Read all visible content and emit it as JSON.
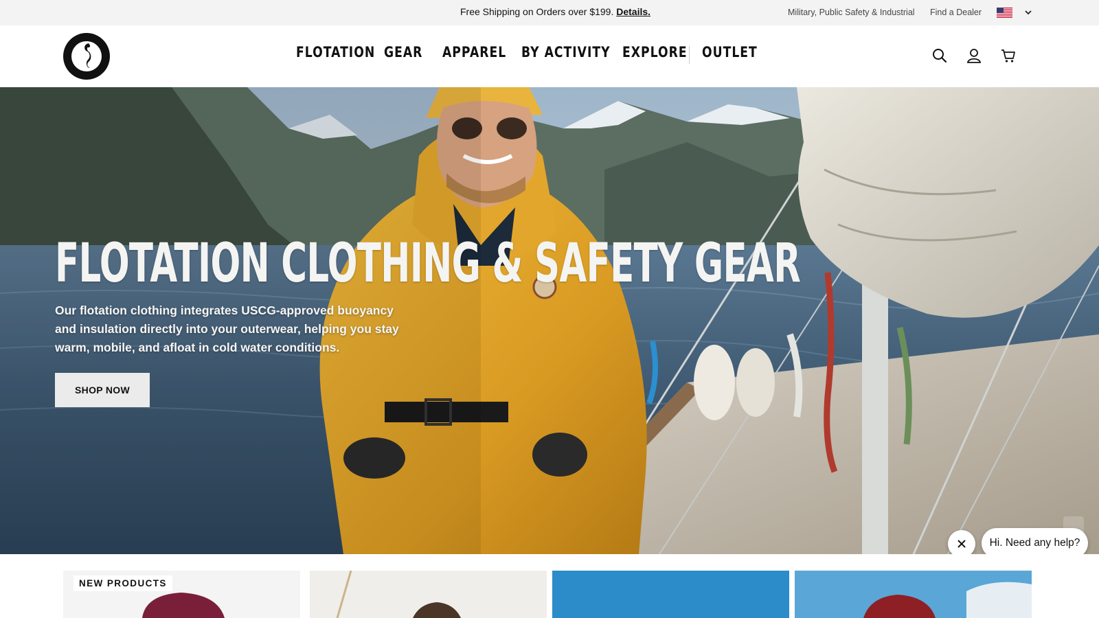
{
  "announcement": {
    "promo_text": "Free Shipping on Orders over $199.",
    "promo_link": "Details.",
    "links": [
      "Military, Public Safety & Industrial",
      "Find a Dealer"
    ],
    "country_flag": "us-flag-icon"
  },
  "header": {
    "brand": "MUSTANG SURVIVAL",
    "nav": [
      "FLOTATION",
      "GEAR",
      "APPAREL",
      "BY ACTIVITY",
      "EXPLORE",
      "OUTLET"
    ],
    "icons": [
      "search-icon",
      "account-icon",
      "cart-icon"
    ]
  },
  "hero": {
    "title": "FLOTATION CLOTHING & SAFETY GEAR",
    "description": "Our flotation clothing integrates USCG-approved buoyancy and insulation directly into your outerwear, helping you stay warm, mobile, and afloat in cold water conditions.",
    "cta": "SHOP NOW"
  },
  "chat": {
    "greeting": "Hi. Need any help?"
  },
  "products": {
    "label": "NEW PRODUCTS"
  },
  "colors": {
    "topbar_bg": "#f3f3f3",
    "jacket_yellow": "#e0a52a",
    "water_blue": "#3f5c78",
    "button_bg": "#ebebeb",
    "chat_black": "#000000"
  }
}
